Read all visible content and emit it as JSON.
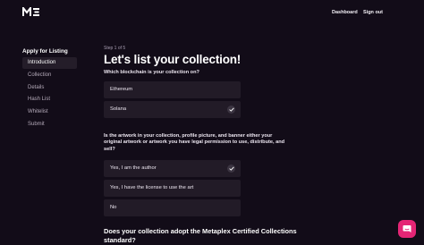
{
  "header": {
    "logo_name": "magic-eden-logo",
    "nav": {
      "dashboard": "Dashboard",
      "sign_out": "Sign out"
    }
  },
  "sidebar": {
    "title": "Apply for Listing",
    "items": [
      {
        "label": "Introduction",
        "active": true
      },
      {
        "label": "Collection",
        "active": false
      },
      {
        "label": "Details",
        "active": false
      },
      {
        "label": "Hash List",
        "active": false
      },
      {
        "label": "Whitelist",
        "active": false
      },
      {
        "label": "Submit",
        "active": false
      }
    ]
  },
  "main": {
    "step": "Step 1 of 5",
    "title": "Let's list your collection!",
    "questions": [
      {
        "text": "Which blockchain is your collection on?",
        "options": [
          {
            "label": "Ethereum",
            "selected": false
          },
          {
            "label": "Solana",
            "selected": true
          }
        ]
      },
      {
        "text": "Is the artwork in your collection, profile picture, and banner either your original artwork or artwork you have legal permission to use, distribute, and sell?",
        "options": [
          {
            "label": "Yes, I am the author",
            "selected": true
          },
          {
            "label": "Yes, I have the license to use the art",
            "selected": false
          },
          {
            "label": "No",
            "selected": false
          }
        ]
      },
      {
        "text": "Does your collection adopt the Metaplex Certified Collections standard?"
      }
    ]
  },
  "colors": {
    "background": "#120c18",
    "panel": "#221b27",
    "active_nav": "#241d29",
    "accent": "#e42575"
  },
  "chat": {
    "icon": "chat-bubble-icon"
  }
}
